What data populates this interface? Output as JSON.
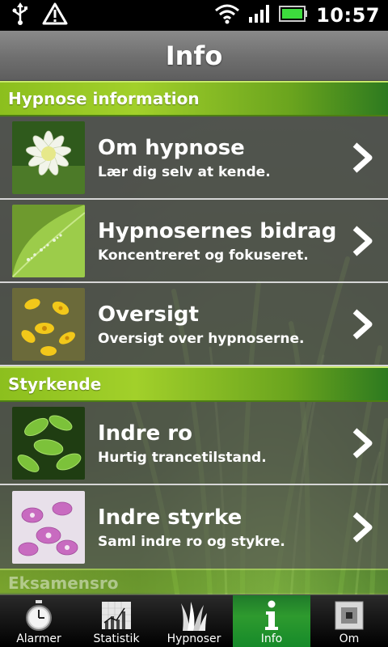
{
  "status_bar": {
    "time": "10:57",
    "icons": [
      "usb-icon",
      "warning-icon",
      "wifi-icon",
      "signal-icon",
      "battery-icon"
    ]
  },
  "header": {
    "title": "Info"
  },
  "sections": [
    {
      "title": "Hypnose information",
      "items": [
        {
          "title": "Om hypnose",
          "subtitle": "Lær dig selv at kende.",
          "thumbnail": "white-flower-image"
        },
        {
          "title": "Hypnosernes bidrag",
          "subtitle": "Koncentreret og fokuseret.",
          "thumbnail": "green-leaf-image"
        },
        {
          "title": "Oversigt",
          "subtitle": "Oversigt over hypnoserne.",
          "thumbnail": "yellow-flower-image"
        }
      ]
    },
    {
      "title": "Styrkende",
      "items": [
        {
          "title": "Indre ro",
          "subtitle": "Hurtig trancetilstand.",
          "thumbnail": "green-leaves-image"
        },
        {
          "title": "Indre styrke",
          "subtitle": "Saml indre ro og stykre.",
          "thumbnail": "orchid-image"
        }
      ]
    },
    {
      "title": "Eksamensro"
    }
  ],
  "tabs": [
    {
      "label": "Alarmer",
      "icon": "stopwatch-icon"
    },
    {
      "label": "Statistik",
      "icon": "chart-icon"
    },
    {
      "label": "Hypnoser",
      "icon": "grass-icon"
    },
    {
      "label": "Info",
      "icon": "info-icon",
      "active": true
    },
    {
      "label": "Om",
      "icon": "square-icon"
    }
  ],
  "colors": {
    "accent_green": "#8cbf1e",
    "active_tab": "#2e9a2e"
  }
}
